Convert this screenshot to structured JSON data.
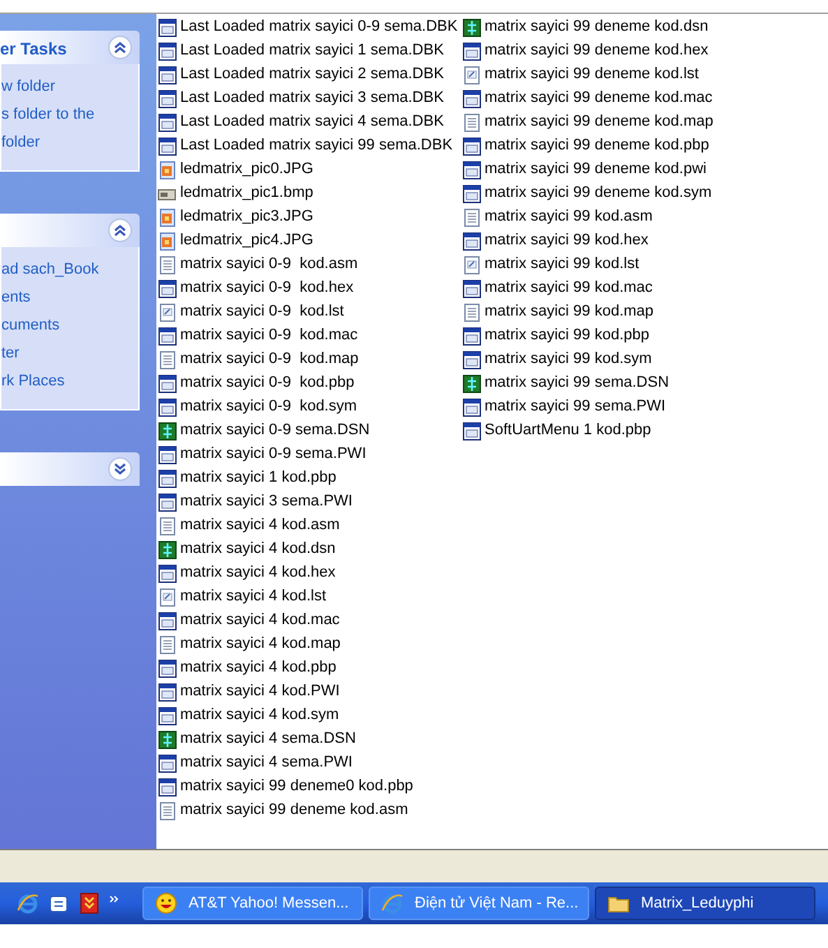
{
  "task_panels": [
    {
      "title": "er Tasks",
      "expanded": true,
      "links": [
        "w folder",
        "s folder to the",
        "folder"
      ]
    },
    {
      "expanded": true,
      "links": [
        "ad sach_Book",
        "ents",
        "cuments",
        "ter",
        "rk Places"
      ]
    },
    {
      "expanded": false
    }
  ],
  "file_columns": [
    [
      {
        "name": "Last Loaded matrix sayici 0-9 sema.DBK",
        "kind": "app"
      },
      {
        "name": "Last Loaded matrix sayici 1 sema.DBK",
        "kind": "app"
      },
      {
        "name": "Last Loaded matrix sayici 2 sema.DBK",
        "kind": "app"
      },
      {
        "name": "Last Loaded matrix sayici 3 sema.DBK",
        "kind": "app"
      },
      {
        "name": "Last Loaded matrix sayici 4 sema.DBK",
        "kind": "app"
      },
      {
        "name": "Last Loaded matrix sayici 99 sema.DBK",
        "kind": "app"
      },
      {
        "name": "ledmatrix_pic0.JPG",
        "kind": "image"
      },
      {
        "name": "ledmatrix_pic1.bmp",
        "kind": "bitmap"
      },
      {
        "name": "ledmatrix_pic3.JPG",
        "kind": "image"
      },
      {
        "name": "ledmatrix_pic4.JPG",
        "kind": "image"
      },
      {
        "name": "matrix sayici 0-9  kod.asm",
        "kind": "text"
      },
      {
        "name": "matrix sayici 0-9  kod.hex",
        "kind": "app"
      },
      {
        "name": "matrix sayici 0-9  kod.lst",
        "kind": "edit"
      },
      {
        "name": "matrix sayici 0-9  kod.mac",
        "kind": "app"
      },
      {
        "name": "matrix sayici 0-9  kod.map",
        "kind": "text"
      },
      {
        "name": "matrix sayici 0-9  kod.pbp",
        "kind": "app"
      },
      {
        "name": "matrix sayici 0-9  kod.sym",
        "kind": "app"
      },
      {
        "name": "matrix sayici 0-9 sema.DSN",
        "kind": "design"
      },
      {
        "name": "matrix sayici 0-9 sema.PWI",
        "kind": "app"
      },
      {
        "name": "matrix sayici 1 kod.pbp",
        "kind": "app"
      },
      {
        "name": "matrix sayici 3 sema.PWI",
        "kind": "app"
      },
      {
        "name": "matrix sayici 4 kod.asm",
        "kind": "text"
      },
      {
        "name": "matrix sayici 4 kod.dsn",
        "kind": "design"
      },
      {
        "name": "matrix sayici 4 kod.hex",
        "kind": "app"
      },
      {
        "name": "matrix sayici 4 kod.lst",
        "kind": "edit"
      },
      {
        "name": "matrix sayici 4 kod.mac",
        "kind": "app"
      },
      {
        "name": "matrix sayici 4 kod.map",
        "kind": "text"
      },
      {
        "name": "matrix sayici 4 kod.pbp",
        "kind": "app"
      },
      {
        "name": "matrix sayici 4 kod.PWI",
        "kind": "app"
      },
      {
        "name": "matrix sayici 4 kod.sym",
        "kind": "app"
      },
      {
        "name": "matrix sayici 4 sema.DSN",
        "kind": "design"
      },
      {
        "name": "matrix sayici 4 sema.PWI",
        "kind": "app"
      },
      {
        "name": "matrix sayici 99 deneme0 kod.pbp",
        "kind": "app"
      },
      {
        "name": "matrix sayici 99 deneme kod.asm",
        "kind": "text"
      }
    ],
    [
      {
        "name": "matrix sayici 99 deneme kod.dsn",
        "kind": "design"
      },
      {
        "name": "matrix sayici 99 deneme kod.hex",
        "kind": "app"
      },
      {
        "name": "matrix sayici 99 deneme kod.lst",
        "kind": "edit"
      },
      {
        "name": "matrix sayici 99 deneme kod.mac",
        "kind": "app"
      },
      {
        "name": "matrix sayici 99 deneme kod.map",
        "kind": "text"
      },
      {
        "name": "matrix sayici 99 deneme kod.pbp",
        "kind": "app"
      },
      {
        "name": "matrix sayici 99 deneme kod.pwi",
        "kind": "app"
      },
      {
        "name": "matrix sayici 99 deneme kod.sym",
        "kind": "app"
      },
      {
        "name": "matrix sayici 99 kod.asm",
        "kind": "text"
      },
      {
        "name": "matrix sayici 99 kod.hex",
        "kind": "app"
      },
      {
        "name": "matrix sayici 99 kod.lst",
        "kind": "edit"
      },
      {
        "name": "matrix sayici 99 kod.mac",
        "kind": "app"
      },
      {
        "name": "matrix sayici 99 kod.map",
        "kind": "text"
      },
      {
        "name": "matrix sayici 99 kod.pbp",
        "kind": "app"
      },
      {
        "name": "matrix sayici 99 kod.sym",
        "kind": "app"
      },
      {
        "name": "matrix sayici 99 sema.DSN",
        "kind": "design"
      },
      {
        "name": "matrix sayici 99 sema.PWI",
        "kind": "app"
      },
      {
        "name": "SoftUartMenu 1 kod.pbp",
        "kind": "app"
      }
    ]
  ],
  "taskbar": {
    "quick_launch": [
      {
        "kind": "browser"
      },
      {
        "kind": "mail"
      },
      {
        "kind": "download"
      }
    ],
    "windows": [
      {
        "label": "AT&T Yahoo! Messen...",
        "kind": "smiley",
        "selected": false
      },
      {
        "label": "Điện tử Việt Nam - Re...",
        "kind": "browser",
        "selected": false
      },
      {
        "label": "Matrix_Leduyphi",
        "kind": "folder",
        "selected": true
      }
    ]
  }
}
